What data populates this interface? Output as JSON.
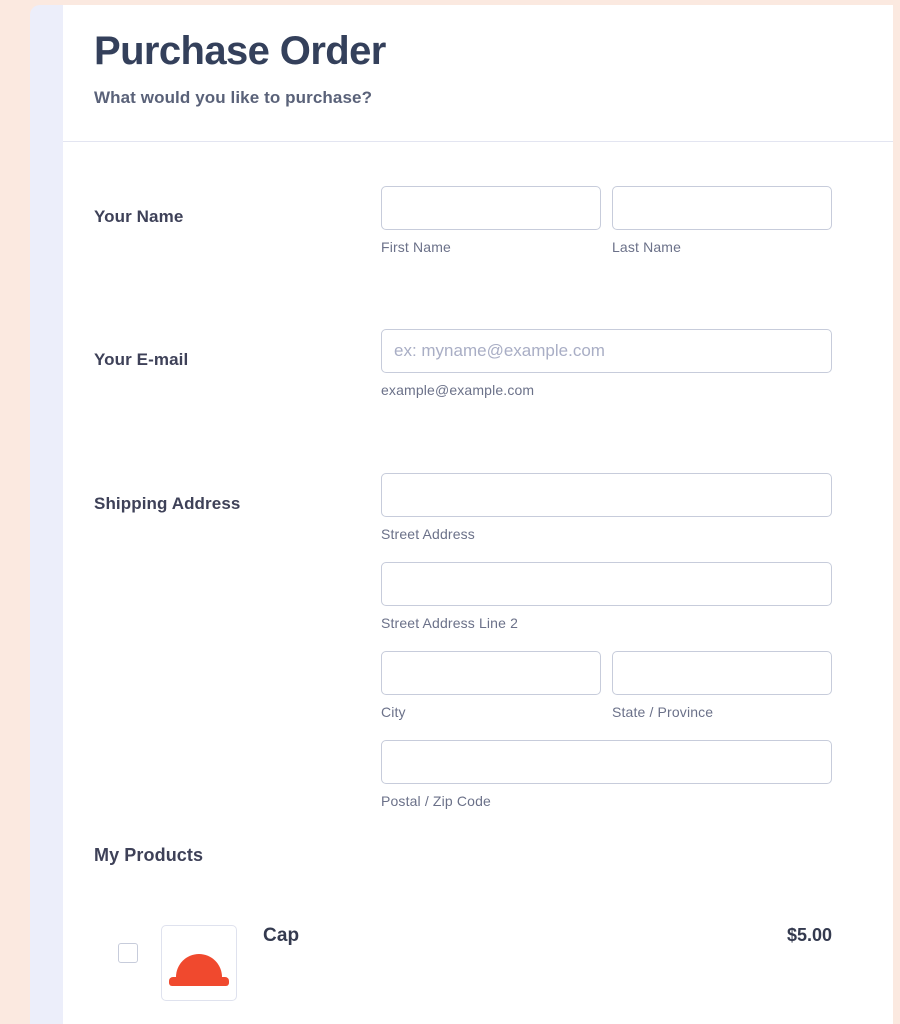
{
  "theme": {
    "page_background": "#fbe9e0",
    "rail_color": "#eceefa",
    "card_background": "#ffffff",
    "heading_color": "#34405b",
    "label_color": "#3e4158",
    "sublabel_color": "#6b7189",
    "input_border": "#c7ccdb",
    "placeholder_color": "#a9aec5",
    "product_accent": "#f0492e"
  },
  "header": {
    "title": "Purchase Order",
    "subtitle": "What would you like to purchase?"
  },
  "fields": {
    "name": {
      "label": "Your Name",
      "first": {
        "value": "",
        "placeholder": "",
        "sublabel": "First Name"
      },
      "last": {
        "value": "",
        "placeholder": "",
        "sublabel": "Last Name"
      }
    },
    "email": {
      "label": "Your E-mail",
      "input": {
        "value": "",
        "placeholder": "ex: myname@example.com",
        "sublabel": "example@example.com"
      }
    },
    "shipping": {
      "label": "Shipping Address",
      "street": {
        "value": "",
        "placeholder": "",
        "sublabel": "Street Address"
      },
      "street2": {
        "value": "",
        "placeholder": "",
        "sublabel": "Street Address Line 2"
      },
      "city": {
        "value": "",
        "placeholder": "",
        "sublabel": "City"
      },
      "state": {
        "value": "",
        "placeholder": "",
        "sublabel": "State / Province"
      },
      "postal": {
        "value": "",
        "placeholder": "",
        "sublabel": "Postal / Zip Code"
      }
    }
  },
  "products": {
    "heading": "My Products",
    "items": [
      {
        "name": "Cap",
        "price": "$5.00",
        "selected": false,
        "image": "red-cap-icon"
      }
    ]
  }
}
